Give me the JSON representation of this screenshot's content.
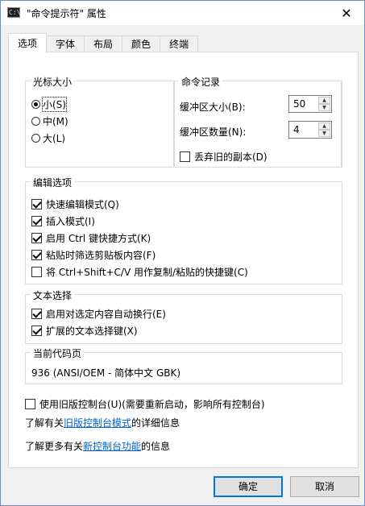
{
  "window": {
    "icon_text": "C:\\",
    "title": "\"命令提示符\" 属性",
    "close_glyph": "✕"
  },
  "tabs": [
    {
      "label": "选项",
      "active": true
    },
    {
      "label": "字体",
      "active": false
    },
    {
      "label": "布局",
      "active": false
    },
    {
      "label": "颜色",
      "active": false
    },
    {
      "label": "终端",
      "active": false
    }
  ],
  "cursor_size": {
    "title": "光标大小",
    "options": [
      {
        "label": "小(S)",
        "selected": true
      },
      {
        "label": "中(M)",
        "selected": false
      },
      {
        "label": "大(L)",
        "selected": false
      }
    ]
  },
  "command_history": {
    "title": "命令记录",
    "buffer_size_label": "缓冲区大小(B):",
    "buffer_size_value": "50",
    "buffer_count_label": "缓冲区数量(N):",
    "buffer_count_value": "4",
    "discard_label": "丢弃旧的副本(D)",
    "discard_checked": false
  },
  "edit_options": {
    "title": "编辑选项",
    "items": [
      {
        "label": "快速编辑模式(Q)",
        "checked": true
      },
      {
        "label": "插入模式(I)",
        "checked": true
      },
      {
        "label": "启用 Ctrl 键快捷方式(K)",
        "checked": true
      },
      {
        "label": "粘贴时筛选剪贴板内容(F)",
        "checked": true
      },
      {
        "label": "将 Ctrl+Shift+C/V 用作复制/粘贴的快捷键(C)",
        "checked": false
      }
    ]
  },
  "text_selection": {
    "title": "文本选择",
    "items": [
      {
        "label": "启用对选定内容自动换行(E)",
        "checked": true
      },
      {
        "label": "扩展的文本选择键(X)",
        "checked": true
      }
    ]
  },
  "codepage": {
    "title": "当前代码页",
    "value": "936   (ANSI/OEM - 简体中文 GBK)"
  },
  "legacy": {
    "label": "使用旧版控制台(U)(需要重新启动，影响所有控制台)",
    "checked": false,
    "info1_prefix": "了解有关",
    "info1_link": "旧版控制台模式",
    "info1_suffix": "的详细信息",
    "info2_prefix": "了解更多有关",
    "info2_link": "新控制台功能",
    "info2_suffix": "的信息"
  },
  "buttons": {
    "ok": "确定",
    "cancel": "取消"
  }
}
